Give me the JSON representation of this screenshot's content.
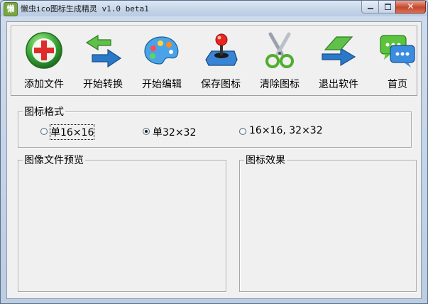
{
  "window": {
    "title": "懒虫ico图标生成精灵 v1.0 beta1",
    "app_icon_char": "懒",
    "close_glyph": "✕"
  },
  "toolbar": {
    "buttons": [
      {
        "label": "添加文件",
        "icon": "add-plus-icon"
      },
      {
        "label": "开始转换",
        "icon": "convert-arrows-icon"
      },
      {
        "label": "开始编辑",
        "icon": "paint-palette-icon"
      },
      {
        "label": "保存图标",
        "icon": "joystick-icon"
      },
      {
        "label": "清除图标",
        "icon": "scissors-icon"
      },
      {
        "label": "退出软件",
        "icon": "exit-arrow-icon"
      },
      {
        "label": "首页",
        "icon": "chat-bubbles-icon"
      }
    ]
  },
  "icon_format": {
    "title": "图标格式",
    "options": [
      {
        "label": "单16×16",
        "selected": false
      },
      {
        "label": "单32×32",
        "selected": true
      },
      {
        "label": "16×16, 32×32",
        "selected": false
      }
    ]
  },
  "preview": {
    "title": "图像文件预览"
  },
  "effect": {
    "title": "图标效果"
  },
  "colors": {
    "accent_blue": "#2a78c8",
    "add_red": "#e02b2b",
    "add_green": "#3aa63a"
  }
}
